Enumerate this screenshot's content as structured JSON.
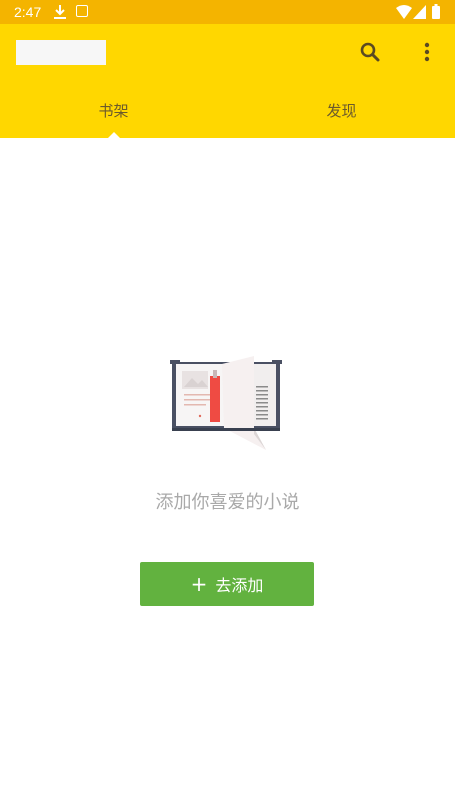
{
  "status_bar": {
    "time": "2:47",
    "icons": [
      "download-icon",
      "app-notification-icon",
      "wifi-icon",
      "signal-icon",
      "battery-icon"
    ]
  },
  "app_bar": {
    "background": "#ffd700",
    "icons": [
      "search-icon",
      "more-vert-icon"
    ],
    "tabs": [
      {
        "label": "书架",
        "selected": true
      },
      {
        "label": "发现",
        "selected": false
      }
    ]
  },
  "empty_state": {
    "message": "添加你喜爱的小说",
    "illustration": "open-book-icon"
  },
  "add_button": {
    "icon": "plus-icon",
    "label": "去添加",
    "color": "#62b23f"
  }
}
